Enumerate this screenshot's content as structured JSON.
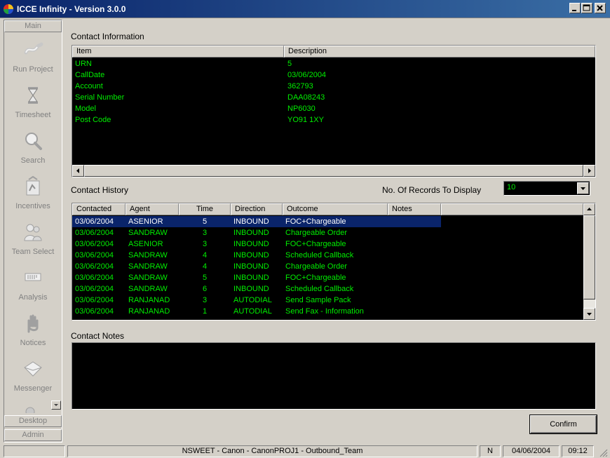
{
  "window": {
    "title": "ICCE Infinity - Version 3.0.0",
    "title_color": "#0a246a"
  },
  "sidebar": {
    "top_label": "Main",
    "items": [
      {
        "label": "Run Project",
        "icon": "run-project-icon"
      },
      {
        "label": "Timesheet",
        "icon": "hourglass-icon"
      },
      {
        "label": "Search",
        "icon": "magnifier-icon"
      },
      {
        "label": "Incentives",
        "icon": "incentives-icon"
      },
      {
        "label": "Team Select",
        "icon": "team-icon"
      },
      {
        "label": "Analysis",
        "icon": "analysis-icon"
      },
      {
        "label": "Notices",
        "icon": "hand-icon"
      },
      {
        "label": "Messenger",
        "icon": "envelope-icon"
      }
    ],
    "bottom_labels": [
      "Desktop",
      "Admin"
    ]
  },
  "contact_info": {
    "title": "Contact Information",
    "headers": [
      "Item",
      "Description"
    ],
    "rows": [
      [
        "URN",
        "5"
      ],
      [
        "CallDate",
        "03/06/2004"
      ],
      [
        "Account",
        "362793"
      ],
      [
        "Serial Number",
        "DAA08243"
      ],
      [
        "Model",
        "NP6030"
      ],
      [
        "Post Code",
        "YO91 1XY"
      ]
    ]
  },
  "contact_history": {
    "title": "Contact History",
    "records_label": "No. Of Records To Display",
    "records_value": "10",
    "headers": [
      "Contacted",
      "Agent",
      "Time",
      "Direction",
      "Outcome",
      "Notes"
    ],
    "rows": [
      [
        "03/06/2004",
        "ASENIOR",
        "5",
        "INBOUND",
        "FOC+Chargeable",
        ""
      ],
      [
        "03/06/2004",
        "SANDRAW",
        "3",
        "INBOUND",
        "Chargeable Order",
        ""
      ],
      [
        "03/06/2004",
        "ASENIOR",
        "3",
        "INBOUND",
        "FOC+Chargeable",
        ""
      ],
      [
        "03/06/2004",
        "SANDRAW",
        "4",
        "INBOUND",
        "Scheduled Callback",
        ""
      ],
      [
        "03/06/2004",
        "SANDRAW",
        "4",
        "INBOUND",
        "Chargeable Order",
        ""
      ],
      [
        "03/06/2004",
        "SANDRAW",
        "5",
        "INBOUND",
        "FOC+Chargeable",
        ""
      ],
      [
        "03/06/2004",
        "SANDRAW",
        "6",
        "INBOUND",
        "Scheduled Callback",
        ""
      ],
      [
        "03/06/2004",
        "RANJANAD",
        "3",
        "AUTODIAL",
        "Send Sample Pack",
        ""
      ],
      [
        "03/06/2004",
        "RANJANAD",
        "1",
        "AUTODIAL",
        "Send Fax - Information",
        ""
      ]
    ]
  },
  "contact_notes": {
    "title": "Contact Notes",
    "text": ""
  },
  "actions": {
    "confirm_label": "Confirm"
  },
  "status": {
    "session": "NSWEET - Canon - CanonPROJ1 - Outbound_Team",
    "indicator": "N",
    "date": "04/06/2004",
    "time": "09:12"
  },
  "colors": {
    "grid_text": "#00ee00",
    "grid_background": "#000000",
    "selection": "#0a246a",
    "chrome": "#d4d0c8"
  }
}
